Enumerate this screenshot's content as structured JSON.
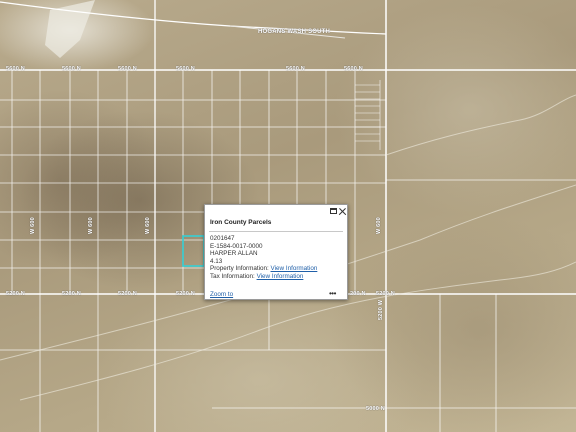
{
  "map": {
    "labels": {
      "hogans_wash": "HOGANS WASH SOUTH",
      "n5600_a": "5600 N",
      "n5600_b": "5600 N",
      "n5600_c": "5600 N",
      "n5600_d": "5600 N",
      "n5600_e": "5600 N",
      "n5600_f": "5600 N",
      "n5200_a": "5200 N",
      "n5200_b": "5200 N",
      "n5200_c": "5200 N",
      "n5200_d": "5200 N",
      "n5200_e": "200 N",
      "n5200_f": "5200 N",
      "n5000": "5000 N",
      "w_a": "W 600",
      "w_b": "W 600",
      "w_c": "W 600",
      "w_d": "W 600",
      "w_e": "5200 W"
    },
    "colors": {
      "road": "#ffffff",
      "parcel_highlight": "#35d0d6"
    }
  },
  "popup": {
    "title": "Iron County Parcels",
    "parcel_id": "0201647",
    "account": "E-1584-0017-0000",
    "owner": "HARPER ALLAN",
    "acres": "4.13",
    "property_info_label": "Property Information:",
    "property_info_link": "View Information",
    "tax_info_label": "Tax Information:",
    "tax_info_link": "View Information",
    "zoom_to": "Zoom to",
    "more": "•••"
  }
}
